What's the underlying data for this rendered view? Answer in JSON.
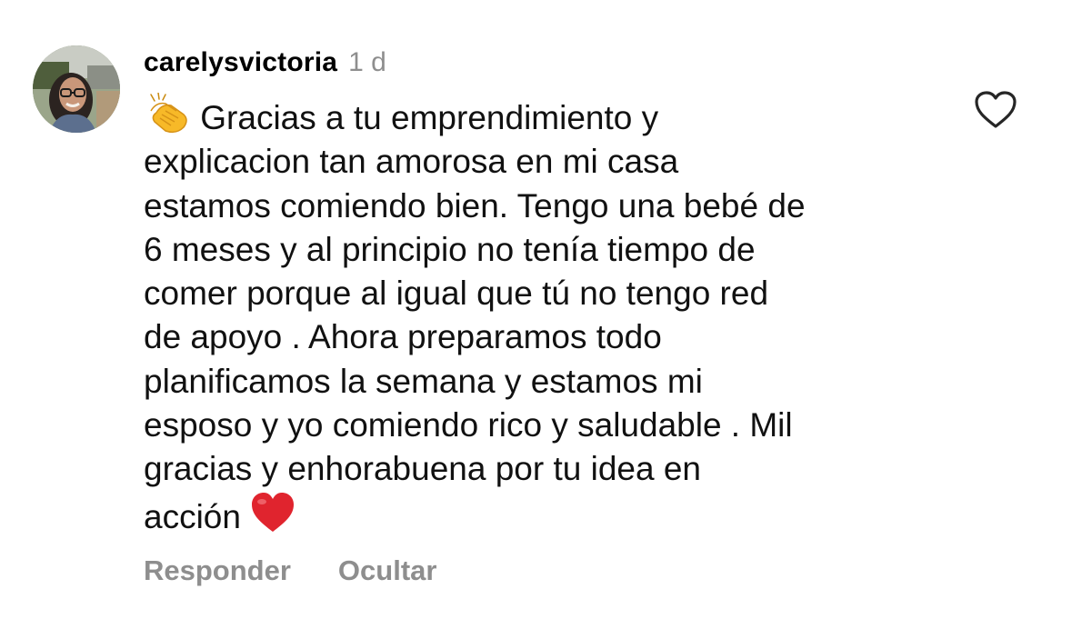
{
  "comment": {
    "username": "carelysvictoria",
    "timestamp": "1 d",
    "lines": [
      "Gracias a tu emprendimiento y",
      "explicacion tan amorosa en mi casa",
      "estamos comiendo bien. Tengo una bebé de",
      "6 meses y al principio no tenía tiempo de",
      "comer porque al igual que tú no tengo red",
      "de apoyo . Ahora preparamos todo",
      "planificamos la semana y estamos mi",
      "esposo y yo comiendo rico y saludable . Mil",
      "gracias y enhorabuena por tu idea en",
      "acción"
    ],
    "leading_emoji": "clapping-hands-emoji",
    "trailing_emoji": "red-heart-emoji",
    "like_icon": "heart-outline-icon"
  },
  "actions": {
    "reply_label": "Responder",
    "hide_label": "Ocultar"
  },
  "colors": {
    "text": "#111111",
    "secondary": "#8e8e8e",
    "background": "#ffffff",
    "heart": "#e0242e"
  }
}
